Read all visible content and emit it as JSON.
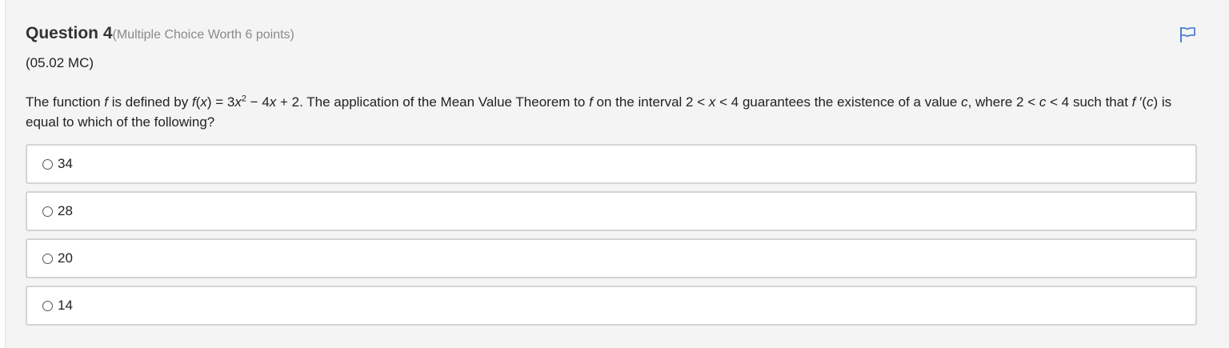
{
  "question": {
    "title": "Question 4",
    "worth": "(Multiple Choice Worth 6 points)",
    "code": "(05.02 MC)",
    "stem": {
      "p1": "The function ",
      "f1": "f",
      "p2": " is defined by ",
      "f2": "f",
      "p3": "(",
      "x1": "x",
      "p4": ") = 3",
      "x2": "x",
      "exp": "2",
      "p5": " − 4",
      "x3": "x",
      "p6": " + 2. The application of the Mean Value Theorem to ",
      "f3": "f",
      "p7": " on the interval 2 < ",
      "x4": "x",
      "p8": " < 4 guarantees the existence of a value ",
      "c1": "c",
      "p9": ", where 2 < ",
      "c2": "c",
      "p10": " < 4 such that ",
      "f4": "f",
      "p11": " ′(",
      "c3": "c",
      "p12": ") is equal to which of the following?"
    },
    "flag_icon": "flag-icon",
    "options": [
      {
        "label": "34"
      },
      {
        "label": "28"
      },
      {
        "label": "20"
      },
      {
        "label": "14"
      }
    ]
  },
  "colors": {
    "accent": "#3b6fd6",
    "panel_bg": "#f4f4f4",
    "option_border": "#d4d4d4"
  }
}
